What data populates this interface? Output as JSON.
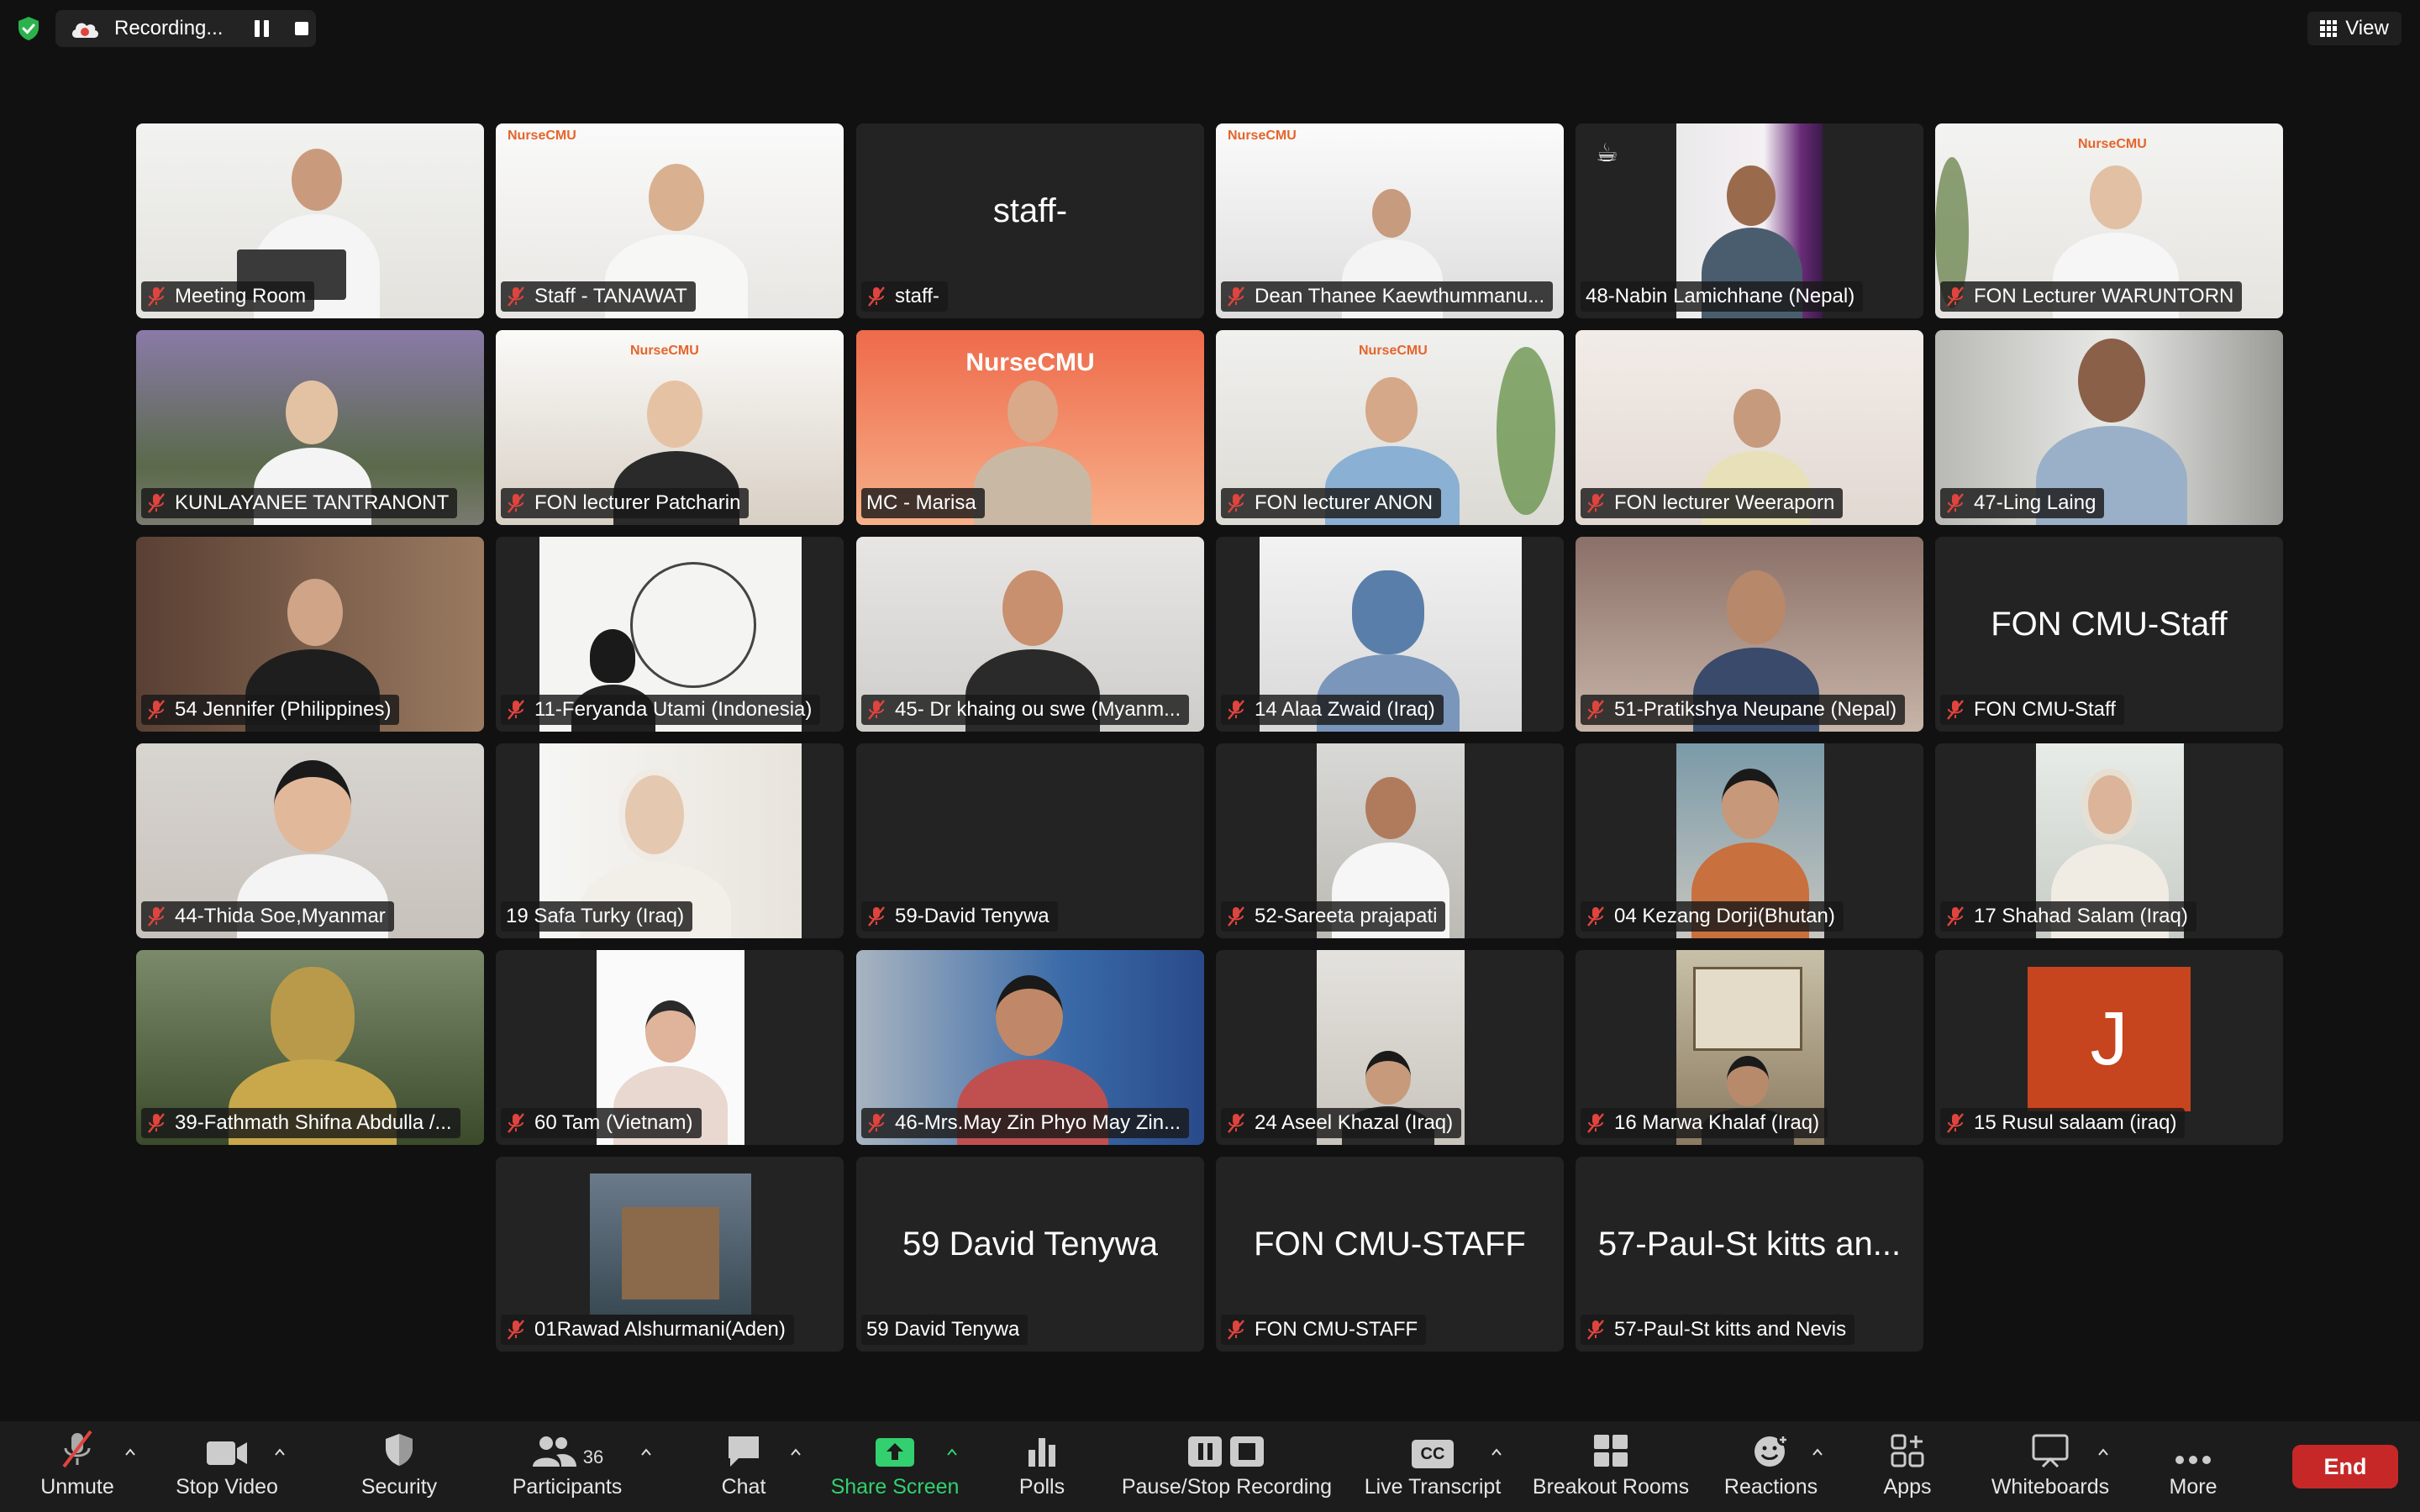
{
  "top_bar": {
    "recording_label": "Recording...",
    "view_label": "View"
  },
  "tiles": [
    {
      "name": "Meeting Room"
    },
    {
      "name": "Staff - TANAWAT"
    },
    {
      "name": "staff-",
      "center": "staff-"
    },
    {
      "name": "Dean Thanee Kaewthummanu..."
    },
    {
      "name": "48-Nabin Lamichhane (Nepal)"
    },
    {
      "name": "FON Lecturer WARUNTORN"
    },
    {
      "name": "KUNLAYANEE TANTRANONT"
    },
    {
      "name": "FON lecturer Patcharin"
    },
    {
      "name": "MC - Marisa",
      "banner": "NurseCMU"
    },
    {
      "name": "FON lecturer ANON"
    },
    {
      "name": "FON lecturer Weeraporn"
    },
    {
      "name": "47-Ling Laing"
    },
    {
      "name": "54 Jennifer (Philippines)"
    },
    {
      "name": "11-Feryanda Utami (Indonesia)"
    },
    {
      "name": "45- Dr khaing ou swe (Myanm..."
    },
    {
      "name": "14 Alaa Zwaid (Iraq)"
    },
    {
      "name": "51-Pratikshya Neupane (Nepal)"
    },
    {
      "name": "FON CMU-Staff",
      "center": "FON CMU-Staff"
    },
    {
      "name": "44-Thida Soe,Myanmar"
    },
    {
      "name": "19 Safa Turky (Iraq)"
    },
    {
      "name": "59-David Tenywa"
    },
    {
      "name": "52-Sareeta prajapati"
    },
    {
      "name": "04 Kezang Dorji(Bhutan)"
    },
    {
      "name": "17 Shahad Salam (Iraq)"
    },
    {
      "name": "39-Fathmath Shifna Abdulla /..."
    },
    {
      "name": "60 Tam (Vietnam)"
    },
    {
      "name": "46-Mrs.May Zin Phyo May Zin..."
    },
    {
      "name": "24 Aseel Khazal (Iraq)"
    },
    {
      "name": "16 Marwa Khalaf (Iraq)"
    },
    {
      "name": "15 Rusul salaam (iraq)",
      "avatar_letter": "J"
    },
    {
      "name": "01Rawad Alshurmani(Aden)"
    },
    {
      "name": "59 David  Tenywa",
      "center": "59 David  Tenywa"
    },
    {
      "name": "FON CMU-STAFF",
      "center": "FON CMU-STAFF"
    },
    {
      "name": "57-Paul-St kitts and Nevis",
      "center": "57-Paul-St kitts an..."
    }
  ],
  "logo_text": "NurseCMU",
  "toolbar": {
    "unmute": "Unmute",
    "stop_video": "Stop Video",
    "security": "Security",
    "participants": "Participants",
    "participants_count": "36",
    "chat": "Chat",
    "share_screen": "Share Screen",
    "polls": "Polls",
    "pause_stop_recording": "Pause/Stop Recording",
    "live_transcript": "Live Transcript",
    "live_transcript_icon": "CC",
    "breakout_rooms": "Breakout Rooms",
    "reactions": "Reactions",
    "apps": "Apps",
    "whiteboards": "Whiteboards",
    "more": "More",
    "end": "End"
  },
  "colors": {
    "background": "#111111",
    "tile": "#232323",
    "active_border": "#2fd26a",
    "share_green": "#33d06f",
    "end_red": "#c62828",
    "muted_red": "#e0443e"
  }
}
